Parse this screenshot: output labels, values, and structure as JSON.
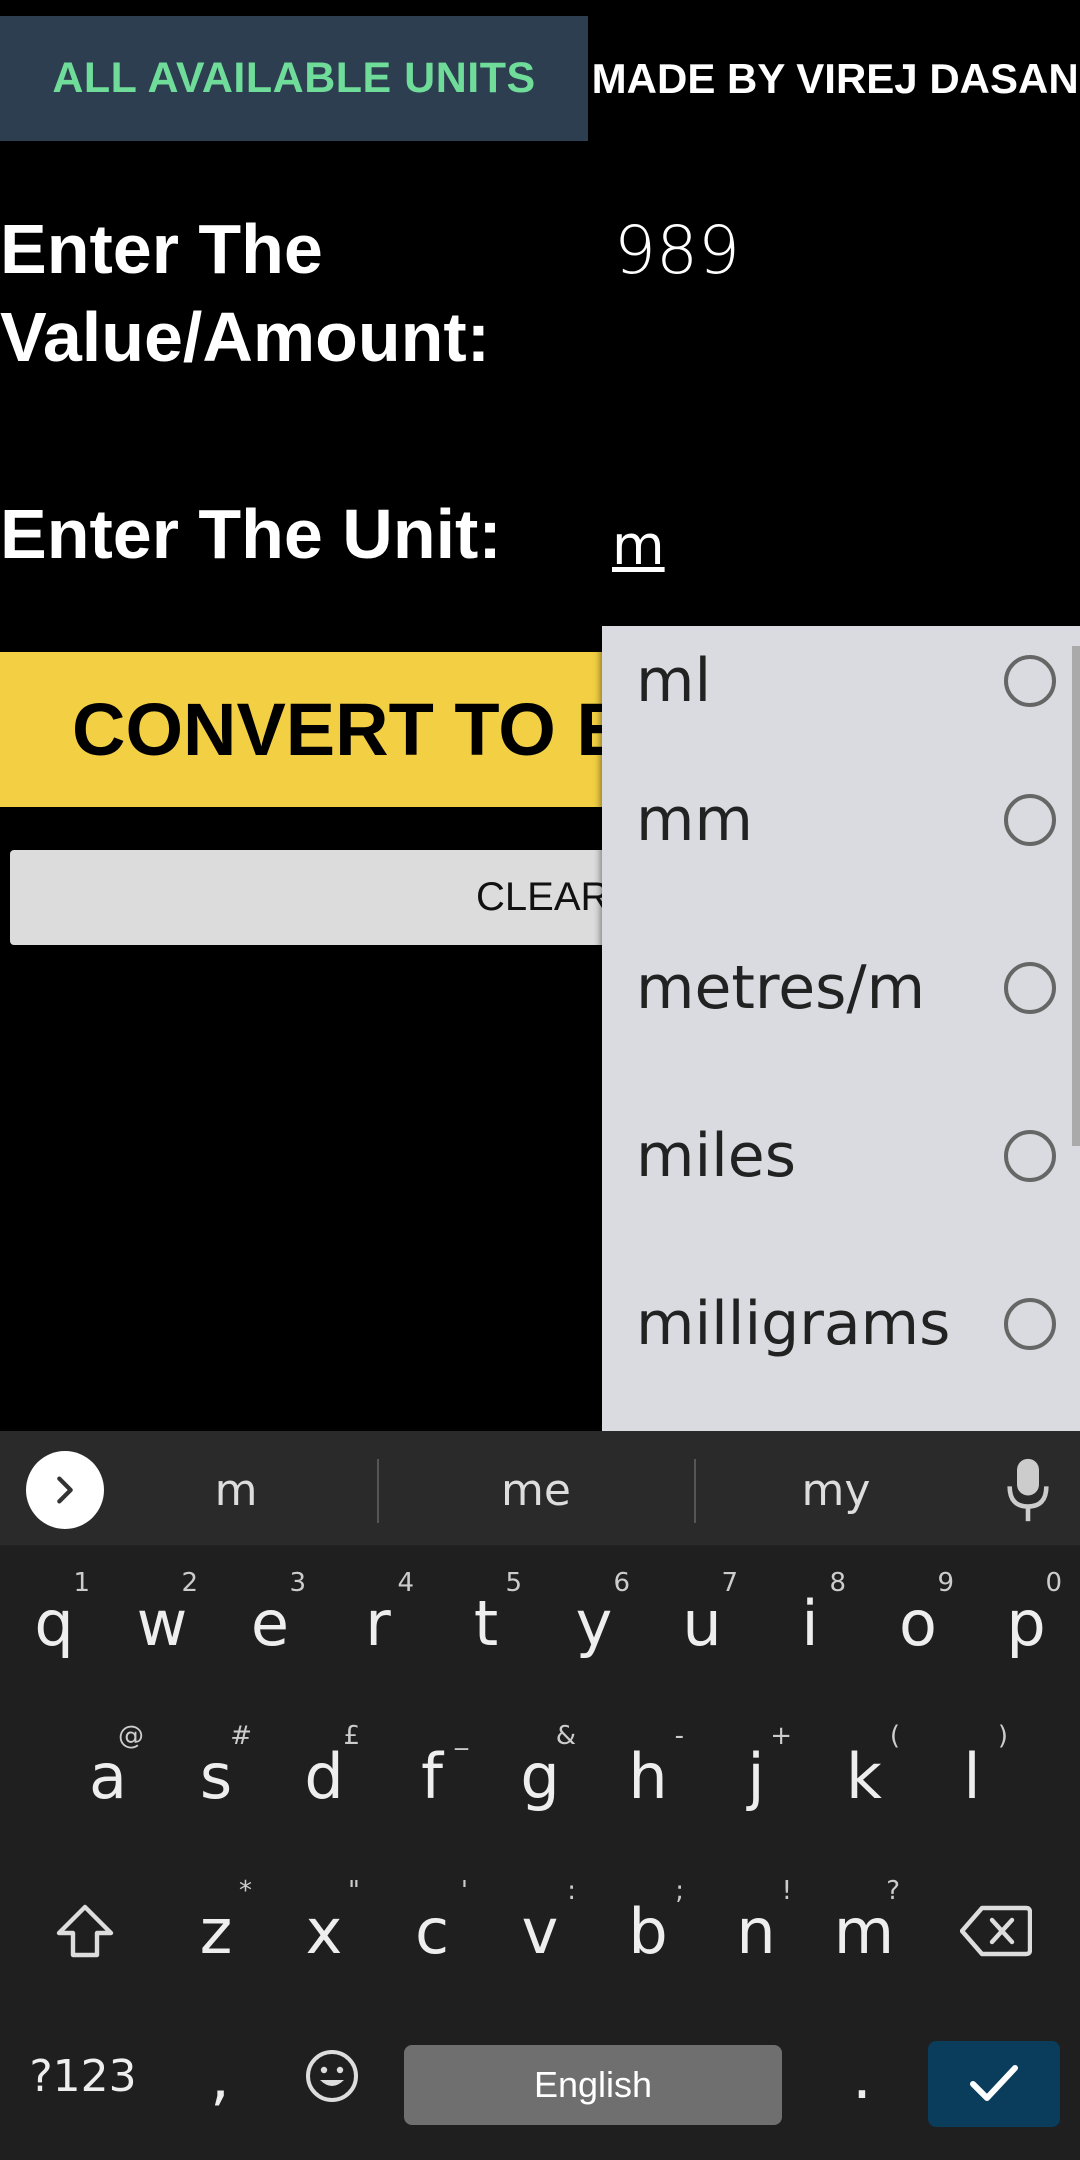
{
  "top_bar": {
    "all_units_label": "ALL AVAILABLE UNITS",
    "made_by_label": "MADE BY VIREJ DASANI"
  },
  "form": {
    "value_label": "Enter The Value/Amount:",
    "value_input": "989",
    "unit_label": "Enter The Unit:",
    "unit_input": "m",
    "convert_label": "CONVERT TO EVERY UNIT",
    "clear_label": "CLEAR"
  },
  "dropdown": {
    "items": [
      "ml",
      "mm",
      "metres/m",
      "miles",
      "milligrams"
    ]
  },
  "keyboard": {
    "suggestions": [
      "m",
      "me",
      "my"
    ],
    "row1": [
      {
        "k": "q",
        "h": "1"
      },
      {
        "k": "w",
        "h": "2"
      },
      {
        "k": "e",
        "h": "3"
      },
      {
        "k": "r",
        "h": "4"
      },
      {
        "k": "t",
        "h": "5"
      },
      {
        "k": "y",
        "h": "6"
      },
      {
        "k": "u",
        "h": "7"
      },
      {
        "k": "i",
        "h": "8"
      },
      {
        "k": "o",
        "h": "9"
      },
      {
        "k": "p",
        "h": "0"
      }
    ],
    "row2": [
      {
        "k": "a",
        "h": "@"
      },
      {
        "k": "s",
        "h": "#"
      },
      {
        "k": "d",
        "h": "£"
      },
      {
        "k": "f",
        "h": "_"
      },
      {
        "k": "g",
        "h": "&"
      },
      {
        "k": "h",
        "h": "-"
      },
      {
        "k": "j",
        "h": "+"
      },
      {
        "k": "k",
        "h": "("
      },
      {
        "k": "l",
        "h": ")"
      }
    ],
    "row3": [
      {
        "k": "z",
        "h": "*"
      },
      {
        "k": "x",
        "h": "\""
      },
      {
        "k": "c",
        "h": "'"
      },
      {
        "k": "v",
        "h": ":"
      },
      {
        "k": "b",
        "h": ";"
      },
      {
        "k": "n",
        "h": "!"
      },
      {
        "k": "m",
        "h": "?"
      }
    ],
    "symbols_label": "?123",
    "comma_label": ",",
    "space_label": "English",
    "period_label": "."
  }
}
